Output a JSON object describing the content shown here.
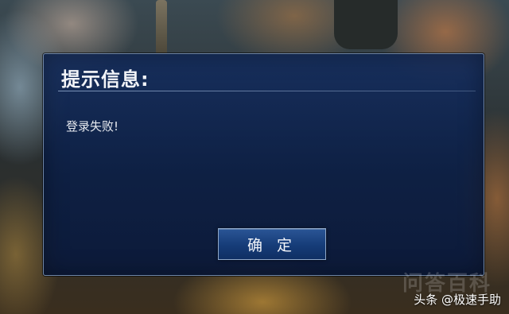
{
  "dialog": {
    "title": "提示信息:",
    "message": "登录失败!",
    "confirm_label": "确 定"
  },
  "watermarks": {
    "faint": "问答百科",
    "credit": "头条 @极速手助"
  },
  "colors": {
    "dialog_bg": "#142d5f",
    "dialog_border": "#6f86a6",
    "button_bg": "#163c78",
    "text": "#f2f4f8"
  }
}
